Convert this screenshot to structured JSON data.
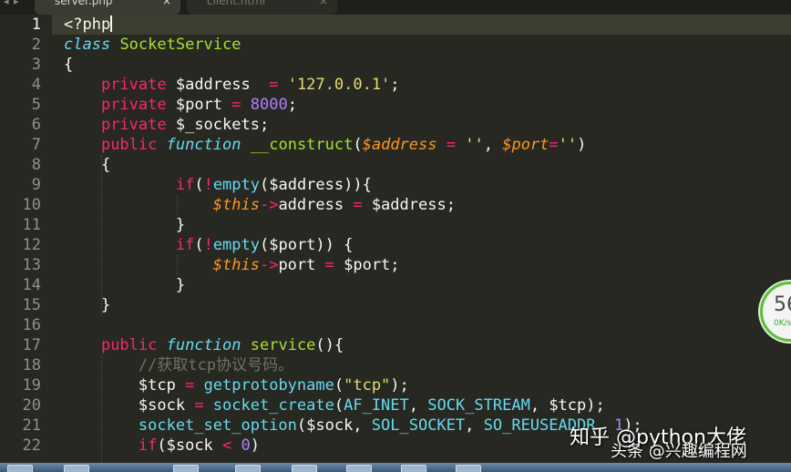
{
  "tabs": [
    {
      "label": "server.php",
      "close": "×"
    },
    {
      "label": "client.html",
      "close": "×"
    }
  ],
  "nav_arrows": "◂ ▸",
  "line_numbers": [
    "1",
    "2",
    "3",
    "4",
    "5",
    "6",
    "7",
    "8",
    "9",
    "10",
    "11",
    "12",
    "13",
    "14",
    "15",
    "16",
    "17",
    "18",
    "19",
    "20",
    "21",
    "22"
  ],
  "current_line": 1,
  "code_lines": [
    [
      {
        "t": "<?php",
        "c": "pl"
      }
    ],
    [
      {
        "t": "class",
        "c": "ty"
      },
      {
        "t": " ",
        "c": "pl"
      },
      {
        "t": "SocketService",
        "c": "fn"
      }
    ],
    [
      {
        "t": "{",
        "c": "pl"
      }
    ],
    [
      {
        "t": "    ",
        "c": "pl"
      },
      {
        "t": "private",
        "c": "kw"
      },
      {
        "t": " $address  ",
        "c": "pl"
      },
      {
        "t": "=",
        "c": "kw"
      },
      {
        "t": " ",
        "c": "pl"
      },
      {
        "t": "'127.0.0.1'",
        "c": "str"
      },
      {
        "t": ";",
        "c": "pl"
      }
    ],
    [
      {
        "t": "    ",
        "c": "pl"
      },
      {
        "t": "private",
        "c": "kw"
      },
      {
        "t": " $port ",
        "c": "pl"
      },
      {
        "t": "=",
        "c": "kw"
      },
      {
        "t": " ",
        "c": "pl"
      },
      {
        "t": "8000",
        "c": "num"
      },
      {
        "t": ";",
        "c": "pl"
      }
    ],
    [
      {
        "t": "    ",
        "c": "pl"
      },
      {
        "t": "private",
        "c": "kw"
      },
      {
        "t": " $_sockets;",
        "c": "pl"
      }
    ],
    [
      {
        "t": "    ",
        "c": "pl"
      },
      {
        "t": "public",
        "c": "kw"
      },
      {
        "t": " ",
        "c": "pl"
      },
      {
        "t": "function",
        "c": "ty"
      },
      {
        "t": " ",
        "c": "pl"
      },
      {
        "t": "__construct",
        "c": "fn"
      },
      {
        "t": "(",
        "c": "pl"
      },
      {
        "t": "$address",
        "c": "par"
      },
      {
        "t": " ",
        "c": "pl"
      },
      {
        "t": "=",
        "c": "kw"
      },
      {
        "t": " ",
        "c": "pl"
      },
      {
        "t": "''",
        "c": "str"
      },
      {
        "t": ", ",
        "c": "pl"
      },
      {
        "t": "$port",
        "c": "par"
      },
      {
        "t": "=",
        "c": "kw"
      },
      {
        "t": "''",
        "c": "str"
      },
      {
        "t": ")",
        "c": "pl"
      }
    ],
    [
      {
        "t": "    {",
        "c": "pl"
      }
    ],
    [
      {
        "t": "            ",
        "c": "pl"
      },
      {
        "t": "if",
        "c": "kw"
      },
      {
        "t": "(",
        "c": "pl"
      },
      {
        "t": "!",
        "c": "kw"
      },
      {
        "t": "empty",
        "c": "bi"
      },
      {
        "t": "($address)){",
        "c": "pl"
      }
    ],
    [
      {
        "t": "                ",
        "c": "pl"
      },
      {
        "t": "$this",
        "c": "par"
      },
      {
        "t": "->",
        "c": "kw"
      },
      {
        "t": "address ",
        "c": "pl"
      },
      {
        "t": "=",
        "c": "kw"
      },
      {
        "t": " $address;",
        "c": "pl"
      }
    ],
    [
      {
        "t": "            }",
        "c": "pl"
      }
    ],
    [
      {
        "t": "            ",
        "c": "pl"
      },
      {
        "t": "if",
        "c": "kw"
      },
      {
        "t": "(",
        "c": "pl"
      },
      {
        "t": "!",
        "c": "kw"
      },
      {
        "t": "empty",
        "c": "bi"
      },
      {
        "t": "($port)) {",
        "c": "pl"
      }
    ],
    [
      {
        "t": "                ",
        "c": "pl"
      },
      {
        "t": "$this",
        "c": "par"
      },
      {
        "t": "->",
        "c": "kw"
      },
      {
        "t": "port ",
        "c": "pl"
      },
      {
        "t": "=",
        "c": "kw"
      },
      {
        "t": " $port;",
        "c": "pl"
      }
    ],
    [
      {
        "t": "            }",
        "c": "pl"
      }
    ],
    [
      {
        "t": "    }",
        "c": "pl"
      }
    ],
    [
      {
        "t": "",
        "c": "pl"
      }
    ],
    [
      {
        "t": "    ",
        "c": "pl"
      },
      {
        "t": "public",
        "c": "kw"
      },
      {
        "t": " ",
        "c": "pl"
      },
      {
        "t": "function",
        "c": "ty"
      },
      {
        "t": " ",
        "c": "pl"
      },
      {
        "t": "service",
        "c": "fn"
      },
      {
        "t": "(){",
        "c": "pl"
      }
    ],
    [
      {
        "t": "        ",
        "c": "pl"
      },
      {
        "t": "//获取tcp协议号码。",
        "c": "cm"
      }
    ],
    [
      {
        "t": "        $tcp ",
        "c": "pl"
      },
      {
        "t": "=",
        "c": "kw"
      },
      {
        "t": " ",
        "c": "pl"
      },
      {
        "t": "getprotobyname",
        "c": "bi"
      },
      {
        "t": "(",
        "c": "pl"
      },
      {
        "t": "\"tcp\"",
        "c": "str"
      },
      {
        "t": ");",
        "c": "pl"
      }
    ],
    [
      {
        "t": "        $sock ",
        "c": "pl"
      },
      {
        "t": "=",
        "c": "kw"
      },
      {
        "t": " ",
        "c": "pl"
      },
      {
        "t": "socket_create",
        "c": "bi"
      },
      {
        "t": "(",
        "c": "pl"
      },
      {
        "t": "AF_INET",
        "c": "bi"
      },
      {
        "t": ", ",
        "c": "pl"
      },
      {
        "t": "SOCK_STREAM",
        "c": "bi"
      },
      {
        "t": ", $tcp);",
        "c": "pl"
      }
    ],
    [
      {
        "t": "        ",
        "c": "pl"
      },
      {
        "t": "socket_set_option",
        "c": "bi"
      },
      {
        "t": "($sock, ",
        "c": "pl"
      },
      {
        "t": "SOL_SOCKET",
        "c": "bi"
      },
      {
        "t": ", ",
        "c": "pl"
      },
      {
        "t": "SO_REUSEADDR",
        "c": "bi"
      },
      {
        "t": ", ",
        "c": "pl"
      },
      {
        "t": "1",
        "c": "num"
      },
      {
        "t": ");",
        "c": "pl"
      }
    ],
    [
      {
        "t": "        ",
        "c": "pl"
      },
      {
        "t": "if",
        "c": "kw"
      },
      {
        "t": "($sock ",
        "c": "pl"
      },
      {
        "t": "<",
        "c": "kw"
      },
      {
        "t": " ",
        "c": "pl"
      },
      {
        "t": "0",
        "c": "num"
      },
      {
        "t": ")",
        "c": "pl"
      }
    ]
  ],
  "perf_widget": {
    "percent": "56",
    "sub": "0K/s",
    "ring_color": "#5cbf3a"
  },
  "watermark": {
    "line1": "知乎 @python大佬",
    "line2": "头条 @兴趣编程网"
  },
  "colors": {
    "background": "#272822",
    "keyword": "#f92672",
    "function": "#a6e22e",
    "type": "#66d9ef",
    "string": "#e6db74",
    "number": "#ae81ff",
    "parameter": "#fd971f",
    "comment": "#75715e",
    "text": "#f8f8f2"
  }
}
